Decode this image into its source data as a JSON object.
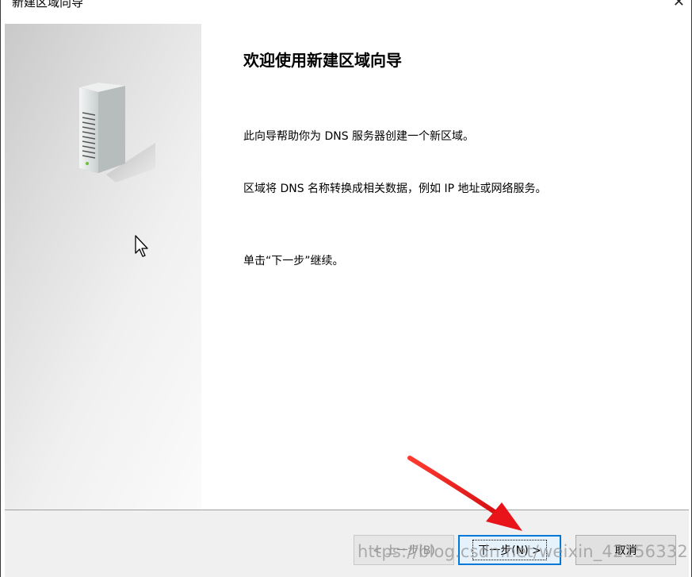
{
  "window": {
    "title": "新建区域向导",
    "close_glyph": "✕"
  },
  "side_panel": {
    "icon": "server-icon",
    "cursor_icon": "mouse-pointer-icon"
  },
  "content": {
    "heading": "欢迎使用新建区域向导",
    "paragraph1": "此向导帮助你为 DNS 服务器创建一个新区域。",
    "paragraph2": "区域将 DNS 名称转换成相关数据，例如 IP 地址或网络服务。",
    "paragraph3": "单击“下一步”继续。"
  },
  "footer": {
    "back_label": "< 上一步(B)",
    "next_label": "下一步(N) >",
    "cancel_label": "取消"
  },
  "annotation": {
    "arrow_color": "#e8141a"
  },
  "watermark": {
    "text": "https://blog.csdn.net/weixin_42156332"
  }
}
